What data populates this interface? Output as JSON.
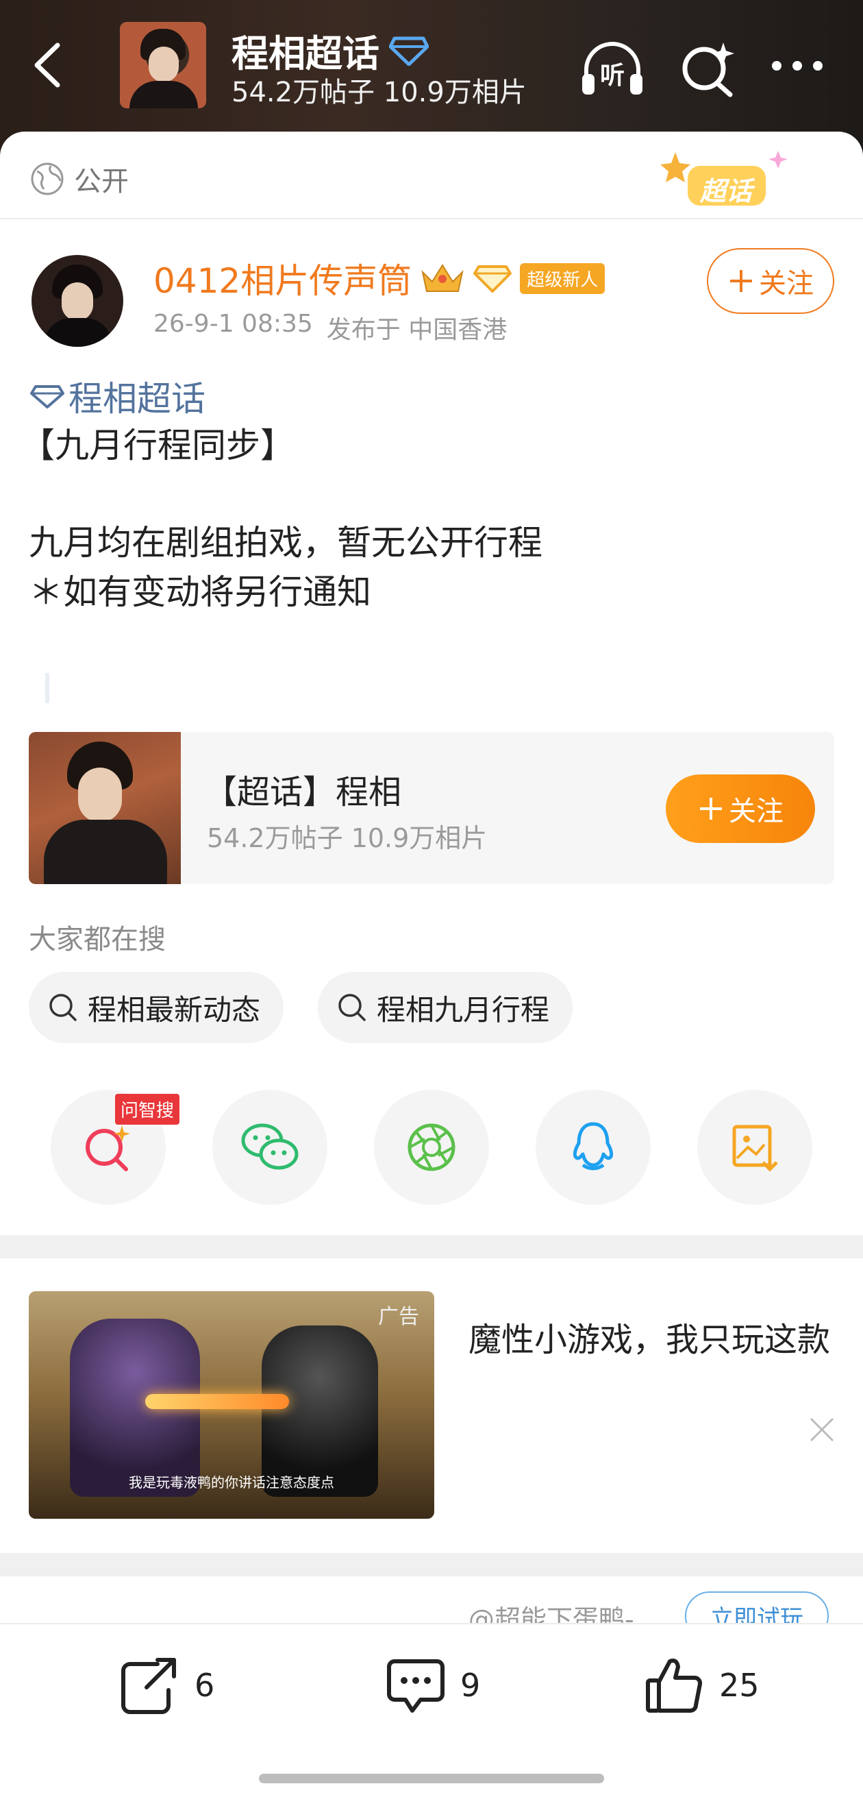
{
  "header": {
    "title": "程相超话",
    "subtitle": "54.2万帖子 10.9万相片",
    "back_icon": "chevron-left-icon",
    "listen_label": "听",
    "icons": [
      "headphones-listen-icon",
      "search-sparkle-icon",
      "more-dots-icon"
    ]
  },
  "visibility": {
    "label": "公开",
    "icon": "globe-icon"
  },
  "badge": {
    "label": "超话"
  },
  "author": {
    "name": "0412相片传声筒",
    "new_badge": "超级新人",
    "time": "26-9-1 08:35",
    "location": "发布于 中国香港",
    "follow_label": "关注"
  },
  "post": {
    "topic": "程相超话",
    "lines": [
      "【九月行程同步】",
      "九月均在剧组拍戏，暂无公开行程",
      "＊如有变动将另行通知"
    ]
  },
  "topic_card": {
    "title": "【超话】程相",
    "subtitle": "54.2万帖子 10.9万相片",
    "follow_label": "关注"
  },
  "searches": {
    "label": "大家都在搜",
    "items": [
      "程相最新动态",
      "程相九月行程"
    ]
  },
  "share": {
    "zhisou_tag": "问智搜",
    "targets": [
      "zhisou-search-icon",
      "wechat-icon",
      "moments-icon",
      "qq-icon",
      "save-image-icon"
    ]
  },
  "ad": {
    "tag": "广告",
    "caption": "我是玩毒液鸭的你讲话注意态度点",
    "title": "魔性小游戏，我只玩这款",
    "source": "@超能下蛋鸭-…",
    "cta": "立即试玩"
  },
  "tabs_peek": {
    "left": "转发 6   评论 9",
    "right": "赞 25"
  },
  "actions": {
    "repost": "6",
    "comment": "9",
    "like": "25"
  },
  "colors": {
    "accent": "#f07a1e",
    "link": "#53739d",
    "follow_gradient": "#ff9f1a"
  }
}
